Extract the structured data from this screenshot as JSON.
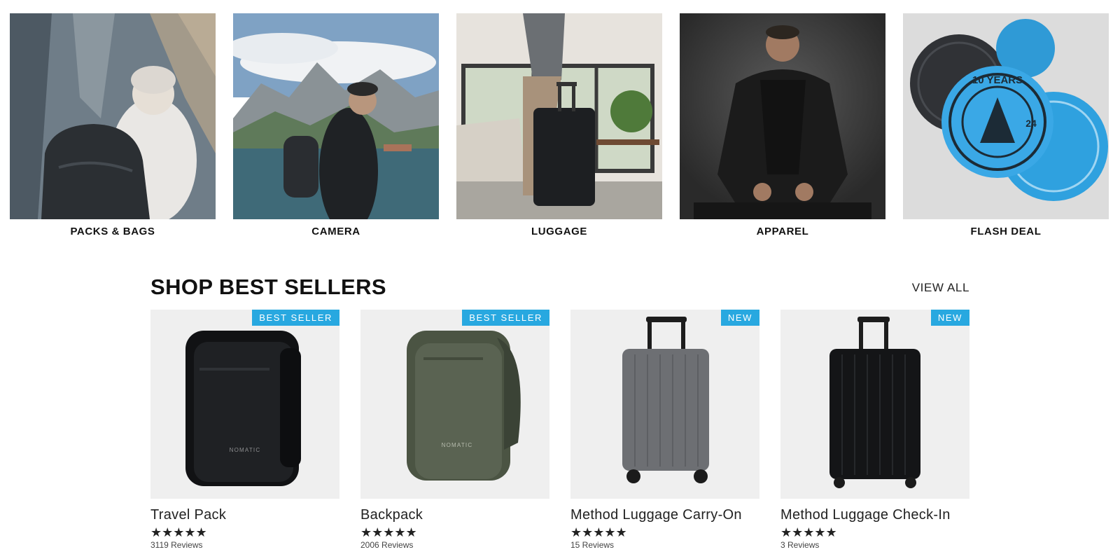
{
  "categories": [
    {
      "label": "PACKS & BAGS",
      "icon": "packs-bags-photo"
    },
    {
      "label": "CAMERA",
      "icon": "camera-photo"
    },
    {
      "label": "LUGGAGE",
      "icon": "luggage-photo"
    },
    {
      "label": "APPAREL",
      "icon": "apparel-photo"
    },
    {
      "label": "FLASH DEAL",
      "icon": "flash-deal-photo"
    }
  ],
  "best_sellers": {
    "title": "SHOP BEST SELLERS",
    "view_all": "VIEW ALL",
    "products": [
      {
        "name": "Travel Pack",
        "badge": "BEST SELLER",
        "stars": "★★★★★",
        "rating": 5,
        "reviews": "3119 Reviews"
      },
      {
        "name": "Backpack",
        "badge": "BEST SELLER",
        "stars": "★★★★★",
        "rating": 5,
        "reviews": "2006 Reviews"
      },
      {
        "name": "Method Luggage Carry-On",
        "badge": "NEW",
        "stars": "★★★★★",
        "rating": 5,
        "reviews": "15 Reviews"
      },
      {
        "name": "Method Luggage Check-In",
        "badge": "NEW",
        "stars": "★★★★★",
        "rating": 5,
        "reviews": "3 Reviews"
      }
    ]
  },
  "flash_deal_sticker": {
    "text_1": "10 YEARS",
    "text_2": "24"
  },
  "product_brand_mark": "NOMATIC",
  "colors": {
    "badge": "#28a8e0",
    "tile_bg": "#efefef",
    "text": "#111111"
  }
}
